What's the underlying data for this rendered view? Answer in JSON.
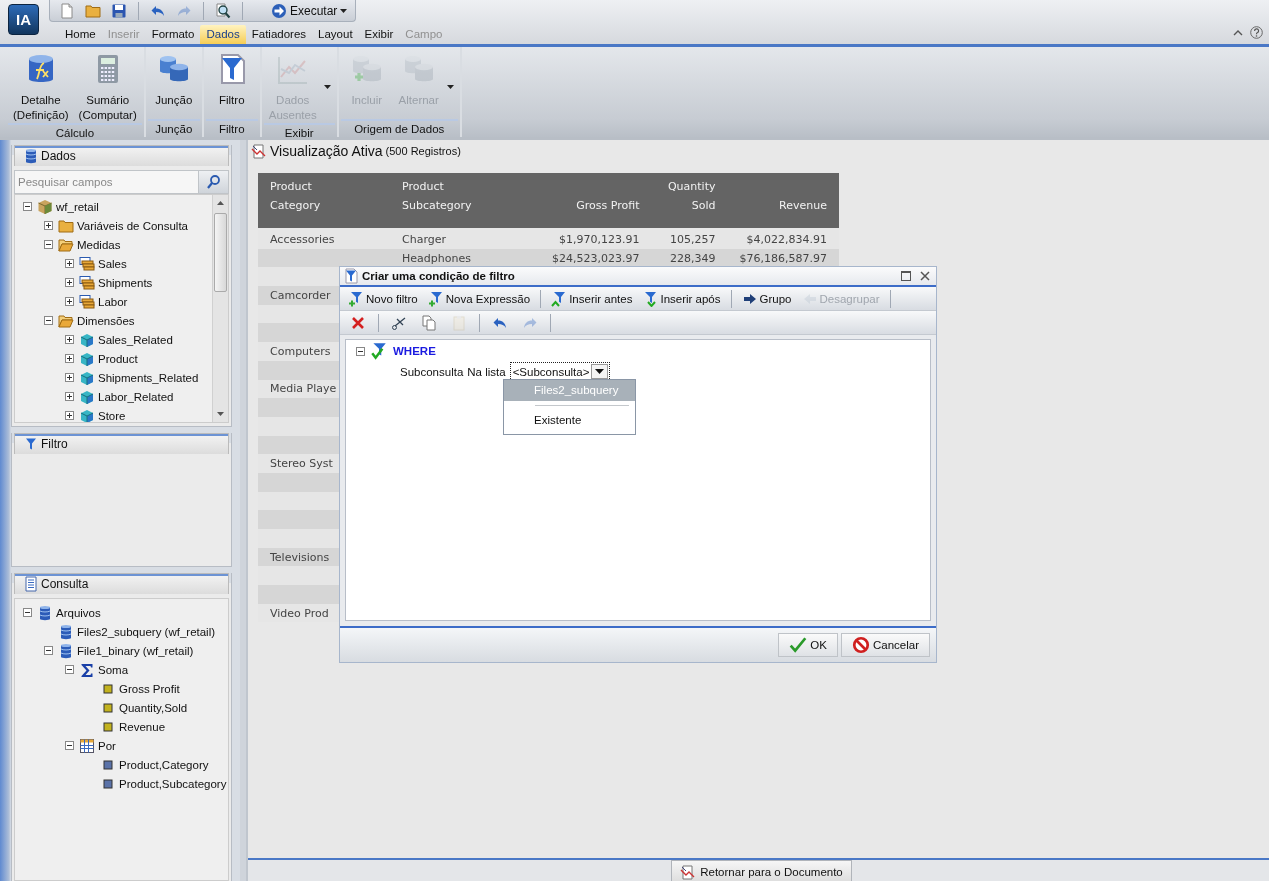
{
  "app": {
    "logo": "IA"
  },
  "quick_access": [
    {
      "kind": "new",
      "disabled": false
    },
    {
      "kind": "open",
      "disabled": false
    },
    {
      "kind": "save",
      "disabled": false
    },
    {
      "kind": "undo",
      "disabled": false
    },
    {
      "kind": "redo",
      "disabled": true
    },
    {
      "kind": "preview",
      "disabled": false
    }
  ],
  "run_button": {
    "label": "Executar"
  },
  "menu_tabs": [
    {
      "label": "Home",
      "selected": false,
      "disabled": false
    },
    {
      "label": "Inserir",
      "selected": false,
      "disabled": true
    },
    {
      "label": "Formato",
      "selected": false,
      "disabled": false
    },
    {
      "label": "Dados",
      "selected": true,
      "disabled": false
    },
    {
      "label": "Fatiadores",
      "selected": false,
      "disabled": false
    },
    {
      "label": "Layout",
      "selected": false,
      "disabled": false
    },
    {
      "label": "Exibir",
      "selected": false,
      "disabled": false
    },
    {
      "label": "Campo",
      "selected": false,
      "disabled": true
    }
  ],
  "ribbon": [
    {
      "title": "Cálculo",
      "items": [
        {
          "kind": "detail",
          "lines": [
            "Detalhe",
            "(Definição)"
          ],
          "disabled": false,
          "dropdown": false
        },
        {
          "kind": "summary",
          "lines": [
            "Sumário",
            "(Computar)"
          ],
          "disabled": false,
          "dropdown": false
        }
      ]
    },
    {
      "title": "Junção",
      "items": [
        {
          "kind": "join",
          "lines": [
            "Junção"
          ],
          "disabled": false,
          "dropdown": false
        }
      ]
    },
    {
      "title": "Filtro",
      "items": [
        {
          "kind": "filter",
          "lines": [
            "Filtro"
          ],
          "disabled": false,
          "dropdown": false
        }
      ]
    },
    {
      "title": "Exibir",
      "items": [
        {
          "kind": "missing",
          "lines": [
            "Dados",
            "Ausentes"
          ],
          "disabled": true,
          "dropdown": true
        }
      ]
    },
    {
      "title": "Origem de Dados",
      "items": [
        {
          "kind": "include",
          "lines": [
            "Incluir"
          ],
          "disabled": true,
          "dropdown": false
        },
        {
          "kind": "switch",
          "lines": [
            "Alternar"
          ],
          "disabled": true,
          "dropdown": true
        }
      ]
    }
  ],
  "left_panel": {
    "data": {
      "title": "Dados",
      "search": {
        "placeholder": "Pesquisar campos"
      },
      "tree": [
        {
          "label": "wf_retail",
          "kind": "cube",
          "expanded": true,
          "children": [
            {
              "label": "Variáveis de Consulta",
              "kind": "folder",
              "expanded": false
            },
            {
              "label": "Medidas",
              "kind": "folder-open",
              "expanded": true,
              "children": [
                {
                  "label": "Sales",
                  "kind": "measure",
                  "expanded": false
                },
                {
                  "label": "Shipments",
                  "kind": "measure",
                  "expanded": false
                },
                {
                  "label": "Labor",
                  "kind": "measure",
                  "expanded": false
                }
              ]
            },
            {
              "label": "Dimensões",
              "kind": "folder-open",
              "expanded": true,
              "children": [
                {
                  "label": "Sales_Related",
                  "kind": "dimension",
                  "expanded": false
                },
                {
                  "label": "Product",
                  "kind": "dimension",
                  "expanded": false
                },
                {
                  "label": "Shipments_Related",
                  "kind": "dimension",
                  "expanded": false
                },
                {
                  "label": "Labor_Related",
                  "kind": "dimension",
                  "expanded": false
                },
                {
                  "label": "Store",
                  "kind": "dimension",
                  "expanded": false
                }
              ]
            }
          ]
        }
      ]
    },
    "filter": {
      "title": "Filtro"
    },
    "query": {
      "title": "Consulta",
      "tree": [
        {
          "label": "Arquivos",
          "kind": "database",
          "expanded": true,
          "children": [
            {
              "label": "Files2_subquery (wf_retail)",
              "kind": "database"
            },
            {
              "label": "File1_binary (wf_retail)",
              "kind": "database",
              "expanded": true,
              "children": [
                {
                  "label": "Soma",
                  "kind": "sigma",
                  "expanded": true,
                  "children": [
                    {
                      "label": "Gross Profit",
                      "kind": "field-measure"
                    },
                    {
                      "label": "Quantity,Sold",
                      "kind": "field-measure"
                    },
                    {
                      "label": "Revenue",
                      "kind": "field-measure"
                    }
                  ]
                },
                {
                  "label": "Por",
                  "kind": "grid",
                  "expanded": true,
                  "children": [
                    {
                      "label": "Product,Category",
                      "kind": "field-dim"
                    },
                    {
                      "label": "Product,Subcategory",
                      "kind": "field-dim"
                    }
                  ]
                }
              ]
            }
          ]
        }
      ]
    }
  },
  "view": {
    "title": "Visualização Ativa",
    "count": "(500 Registros)",
    "table": {
      "columns": [
        {
          "lines": [
            "Product",
            "Category"
          ],
          "kind": "text"
        },
        {
          "lines": [
            "Product",
            "Subcategory"
          ],
          "kind": "text"
        },
        {
          "lines": [
            "Gross Profit"
          ],
          "kind": "number"
        },
        {
          "lines": [
            "Quantity",
            "Sold"
          ],
          "kind": "number"
        },
        {
          "lines": [
            "Revenue"
          ],
          "kind": "number"
        }
      ],
      "rows": [
        {
          "category": "Accessories",
          "subcategory": "Charger",
          "gross_profit": "$1,970,123.91",
          "quantity_sold": "105,257",
          "revenue": "$4,022,834.91"
        },
        {
          "subcategory": "Headphones",
          "gross_profit": "$24,523,023.97",
          "quantity_sold": "228,349",
          "revenue": "$76,186,587.97"
        },
        {},
        {
          "category": "Camcorder"
        },
        {},
        {},
        {
          "category": "Computers"
        },
        {},
        {
          "category": "Media Playe"
        },
        {},
        {},
        {},
        {
          "category": "Stereo Syst"
        },
        {},
        {},
        {},
        {},
        {
          "category": "Televisions"
        },
        {},
        {},
        {
          "category": "Video Prod"
        }
      ]
    }
  },
  "status_bar": {
    "button": "Retornar para o Documento"
  },
  "dialog": {
    "title": "Criar uma condição de filtro",
    "toolbar": [
      [
        {
          "kind": "funnel-add",
          "label": "Novo filtro",
          "disabled": false
        },
        {
          "kind": "funnel-add",
          "label": "Nova Expressão",
          "disabled": false
        }
      ],
      [
        {
          "kind": "insert-before",
          "label": "Inserir antes",
          "disabled": false
        },
        {
          "kind": "insert-after",
          "label": "Inserir após",
          "disabled": false
        }
      ],
      [
        {
          "kind": "arrow-right",
          "label": "Grupo",
          "disabled": false
        },
        {
          "kind": "arrow-left",
          "label": "Desagrupar",
          "disabled": true
        }
      ]
    ],
    "edit_toolbar": [
      [
        {
          "kind": "delete",
          "disabled": false
        }
      ],
      [
        {
          "kind": "cut",
          "disabled": false
        },
        {
          "kind": "copy",
          "disabled": false
        },
        {
          "kind": "paste",
          "disabled": true
        }
      ],
      [
        {
          "kind": "undo",
          "disabled": false
        },
        {
          "kind": "redo",
          "disabled": true
        }
      ]
    ],
    "where": {
      "label": "WHERE",
      "expanded": true,
      "condition": {
        "field": "Subconsulta",
        "operator": "Na lista",
        "value": "<Subconsulta>"
      }
    },
    "dropdown": {
      "open": true,
      "options": [
        {
          "label": "Files2_subquery",
          "selected": true,
          "separator_after": true
        },
        {
          "label": "Existente",
          "selected": false,
          "separator_after": false
        }
      ]
    },
    "buttons": [
      {
        "kind": "ok",
        "label": "OK"
      },
      {
        "kind": "cancel",
        "label": "Cancelar"
      }
    ]
  }
}
